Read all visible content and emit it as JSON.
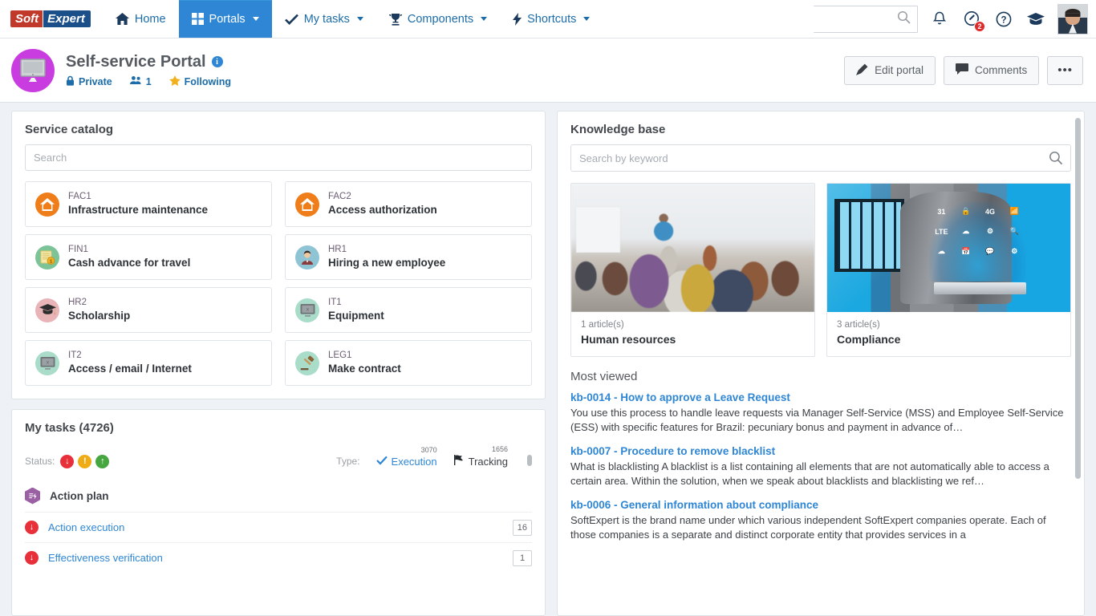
{
  "brand": {
    "part1": "Soft",
    "part2": "Expert"
  },
  "topnav": {
    "items": [
      {
        "label": "Home",
        "icon": "home-icon",
        "caret": false,
        "active": false
      },
      {
        "label": "Portals",
        "icon": "grid-icon",
        "caret": true,
        "active": true
      },
      {
        "label": "My tasks",
        "icon": "check-icon",
        "caret": true,
        "active": false
      },
      {
        "label": "Components",
        "icon": "trophy-icon",
        "caret": true,
        "active": false
      },
      {
        "label": "Shortcuts",
        "icon": "bolt-icon",
        "caret": true,
        "active": false
      }
    ],
    "search_placeholder": "",
    "search_value": "",
    "notification_badge": "",
    "help_badge": "2"
  },
  "portal": {
    "title": "Self-service Portal",
    "visibility": "Private",
    "members": "1",
    "following": "Following",
    "edit_label": "Edit portal",
    "comments_label": "Comments",
    "more_label": "•••"
  },
  "service_catalog": {
    "title": "Service catalog",
    "search_placeholder": "Search",
    "search_value": "",
    "items": [
      {
        "code": "FAC1",
        "name": "Infrastructure maintenance",
        "icon": "house-icon",
        "bg": "#ef7d1a",
        "fg": "#ffffff"
      },
      {
        "code": "FAC2",
        "name": "Access authorization",
        "icon": "house-icon",
        "bg": "#ef7d1a",
        "fg": "#ffffff"
      },
      {
        "code": "FIN1",
        "name": "Cash advance for travel",
        "icon": "invoice-icon",
        "bg": "#7cc398",
        "fg": "#f2e7b0"
      },
      {
        "code": "HR1",
        "name": "Hiring a new employee",
        "icon": "person-icon",
        "bg": "#8fc4d4",
        "fg": "#8a3b3b"
      },
      {
        "code": "HR2",
        "name": "Scholarship",
        "icon": "graduation-icon",
        "bg": "#e8b4b8",
        "fg": "#333333"
      },
      {
        "code": "IT1",
        "name": "Equipment",
        "icon": "monitor-icon",
        "bg": "#a9ddc9",
        "fg": "#6f7478"
      },
      {
        "code": "IT2",
        "name": "Access / email / Internet",
        "icon": "monitor-icon",
        "bg": "#a9ddc9",
        "fg": "#6f7478"
      },
      {
        "code": "LEG1",
        "name": "Make contract",
        "icon": "gavel-icon",
        "bg": "#a9ddc9",
        "fg": "#6f5a3a"
      }
    ]
  },
  "my_tasks": {
    "title": "My tasks (4726)",
    "status_label": "Status:",
    "status_dots": [
      {
        "name": "overdue",
        "color": "#e8303a",
        "glyph": "↓"
      },
      {
        "name": "due-soon",
        "color": "#f0ac15",
        "glyph": "!"
      },
      {
        "name": "on-time",
        "color": "#46a63f",
        "glyph": "↑"
      }
    ],
    "type_label": "Type:",
    "types": [
      {
        "label": "Execution",
        "count": "3070",
        "icon": "check-icon"
      },
      {
        "label": "Tracking",
        "count": "1656",
        "icon": "flag-icon"
      }
    ],
    "groups": [
      {
        "name": "Action plan",
        "icon": "action-plan-icon",
        "rows": [
          {
            "name": "Action execution",
            "count": "16",
            "status": "overdue"
          },
          {
            "name": "Effectiveness verification",
            "count": "1",
            "status": "overdue"
          }
        ]
      }
    ]
  },
  "knowledge_base": {
    "title": "Knowledge base",
    "search_placeholder": "Search by keyword",
    "search_value": "",
    "categories": [
      {
        "count": "1 article(s)",
        "name": "Human resources",
        "image": "seminar-photo"
      },
      {
        "count": "3 article(s)",
        "name": "Compliance",
        "image": "technology-photo"
      }
    ],
    "most_viewed_title": "Most viewed",
    "articles": [
      {
        "title": "kb-0014 - How to approve a Leave Request",
        "text": "You use this process to handle leave requests via Manager Self-Service (MSS) and Employee Self-Service (ESS) with specific features for Brazil: pecuniary bonus and payment in advance of…"
      },
      {
        "title": "kb-0007 - Procedure to remove blacklist",
        "text": "What is blacklisting A blacklist is a list containing all elements that are not automatically able to access a certain area. Within the solution, when we speak about blacklists and blacklisting we ref…"
      },
      {
        "title": "kb-0006 - General information about compliance",
        "text": "SoftExpert is the brand name under which various independent SoftExpert companies operate. Each of those companies is a separate and distinct corporate entity that provides services in a"
      }
    ]
  },
  "colors": {
    "accent": "#2e86d4",
    "nav_active": "#2e86d4",
    "link": "#2e86d4",
    "portal_avatar": "#c83ce0"
  }
}
